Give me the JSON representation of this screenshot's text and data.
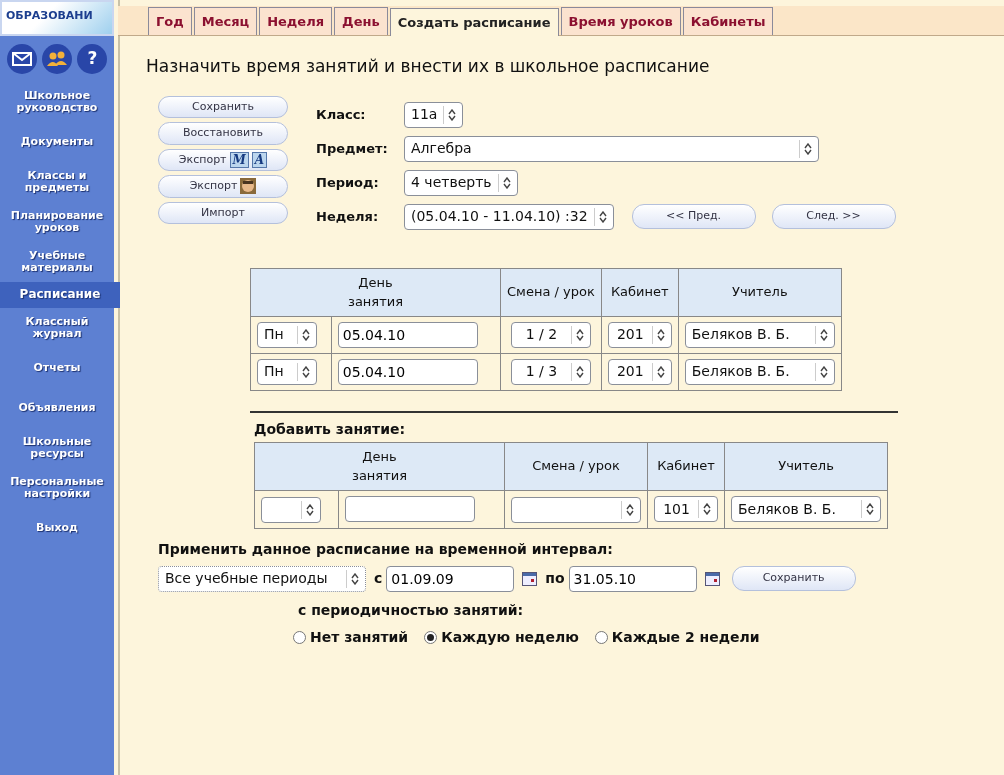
{
  "logo": {
    "text": "ОБРАЗОВАНИ"
  },
  "sidebar": {
    "help": "?",
    "items": [
      {
        "label": "Школьное руководство",
        "selected": false
      },
      {
        "label": "Документы",
        "selected": false
      },
      {
        "label": "Классы и предметы",
        "selected": false
      },
      {
        "label": "Планирование уроков",
        "selected": false
      },
      {
        "label": "Учебные материалы",
        "selected": false
      },
      {
        "label": "Расписание",
        "selected": true
      },
      {
        "label": "Классный журнал",
        "selected": false
      },
      {
        "label": "Отчеты",
        "selected": false
      },
      {
        "label": "Объявления",
        "selected": false
      },
      {
        "label": "Школьные ресурсы",
        "selected": false
      },
      {
        "label": "Персональные настройки",
        "selected": false
      },
      {
        "label": "Выход",
        "selected": false
      }
    ]
  },
  "tabs": [
    {
      "label": "Год",
      "selected": false
    },
    {
      "label": "Месяц",
      "selected": false
    },
    {
      "label": "Неделя",
      "selected": false
    },
    {
      "label": "День",
      "selected": false
    },
    {
      "label": "Создать расписание",
      "selected": true
    },
    {
      "label": "Время уроков",
      "selected": false
    },
    {
      "label": "Кабинеты",
      "selected": false
    }
  ],
  "heading": "Назначить время занятий и внести их в школьное расписание",
  "buttons": [
    {
      "label": "Сохранить",
      "kind": "plain"
    },
    {
      "label": "Восстановить",
      "kind": "plain"
    },
    {
      "label": "Экспорт",
      "kind": "letters",
      "letters": [
        "M",
        "A"
      ]
    },
    {
      "label": "Экспорт",
      "kind": "face"
    },
    {
      "label": "Импорт",
      "kind": "plain"
    }
  ],
  "form": [
    {
      "label": "Класс:",
      "value": "11а"
    },
    {
      "label": "Предмет:",
      "value": "Алгебра"
    },
    {
      "label": "Период:",
      "value": "4 четверть"
    },
    {
      "label": "Неделя:",
      "value": "(05.04.10 - 11.04.10) :32"
    }
  ],
  "week_nav": [
    "<< Пред.",
    "След. >>"
  ],
  "schedule_table": {
    "columns": [
      "День занятия",
      "Смена / урок",
      "Кабинет",
      "Учитель"
    ],
    "rows": [
      {
        "day": "Пн",
        "date": "05.04.10",
        "slot": "1 / 2",
        "room": "201",
        "teacher": "Беляков В. Б."
      },
      {
        "day": "Пн",
        "date": "05.04.10",
        "slot": "1 / 3",
        "room": "201",
        "teacher": "Беляков В. Б."
      }
    ]
  },
  "add_lesson": {
    "title": "Добавить занятие:",
    "columns": [
      "День занятия",
      "Смена / урок",
      "Кабинет",
      "Учитель"
    ],
    "rows": [
      {
        "room": "101",
        "teacher": "Беляков В. Б."
      }
    ]
  },
  "interval": {
    "title": "Применить данное расписание на временной интервал:",
    "period": "Все учебные периоды",
    "from_label": "с",
    "from": "01.09.09",
    "to_label": "по",
    "to": "31.05.10",
    "save": "Сохранить"
  },
  "periodicity": {
    "title": "с периодичностью занятий:",
    "options": [
      {
        "label": "Нет занятий",
        "selected": false
      },
      {
        "label": "Каждую неделю",
        "selected": true
      },
      {
        "label": "Каждые 2 недели",
        "selected": false
      }
    ]
  }
}
